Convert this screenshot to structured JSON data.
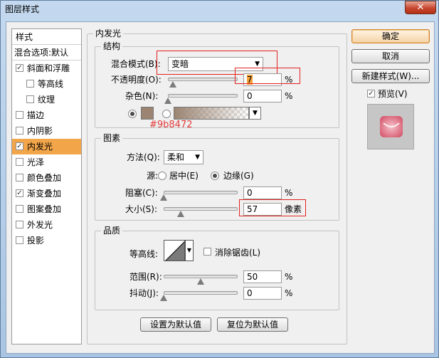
{
  "window": {
    "title": "图层样式",
    "close_label": "✕"
  },
  "style_list": {
    "header": "样式",
    "blend_options": "混合选项:默认",
    "items": [
      {
        "label": "斜面和浮雕",
        "checked": true,
        "active": false,
        "indent": false
      },
      {
        "label": "等高线",
        "checked": false,
        "active": false,
        "indent": true
      },
      {
        "label": "纹理",
        "checked": false,
        "active": false,
        "indent": true
      },
      {
        "label": "描边",
        "checked": false,
        "active": false,
        "indent": false
      },
      {
        "label": "内阴影",
        "checked": false,
        "active": false,
        "indent": false
      },
      {
        "label": "内发光",
        "checked": true,
        "active": true,
        "indent": false
      },
      {
        "label": "光泽",
        "checked": false,
        "active": false,
        "indent": false
      },
      {
        "label": "颜色叠加",
        "checked": false,
        "active": false,
        "indent": false
      },
      {
        "label": "渐变叠加",
        "checked": true,
        "active": false,
        "indent": false
      },
      {
        "label": "图案叠加",
        "checked": false,
        "active": false,
        "indent": false
      },
      {
        "label": "外发光",
        "checked": false,
        "active": false,
        "indent": false
      },
      {
        "label": "投影",
        "checked": false,
        "active": false,
        "indent": false
      }
    ]
  },
  "inner_glow": {
    "section_title": "内发光",
    "structure": {
      "title": "结构",
      "blend_mode_label": "混合模式(B):",
      "blend_mode_value": "变暗",
      "opacity_label": "不透明度(O):",
      "opacity_value": "7",
      "opacity_unit": "%",
      "noise_label": "杂色(N):",
      "noise_value": "0",
      "noise_unit": "%",
      "color_hex": "#9b8472",
      "color_annotation": "#9b8472",
      "gradient_color": "#9b8472"
    },
    "elements": {
      "title": "图素",
      "method_label": "方法(Q):",
      "method_value": "柔和",
      "source_label": "源:",
      "source_center": "居中(E)",
      "source_edge": "边缘(G)",
      "choke_label": "阻塞(C):",
      "choke_value": "0",
      "choke_unit": "%",
      "size_label": "大小(S):",
      "size_value": "57",
      "size_unit": "像素"
    },
    "quality": {
      "title": "品质",
      "contour_label": "等高线:",
      "anti_alias_label": "消除锯齿(L)",
      "range_label": "范围(R):",
      "range_value": "50",
      "range_unit": "%",
      "jitter_label": "抖动(J):",
      "jitter_value": "0",
      "jitter_unit": "%"
    },
    "make_default": "设置为默认值",
    "reset_default": "复位为默认值"
  },
  "actions": {
    "ok": "确定",
    "cancel": "取消",
    "new_style": "新建样式(W)...",
    "preview_label": "预览(V)",
    "preview_checked": true
  },
  "slider_levels": {
    "opacity": 0.07,
    "noise": 0.0,
    "choke": 0.0,
    "size": 0.23,
    "range": 0.5,
    "jitter": 0.0
  }
}
